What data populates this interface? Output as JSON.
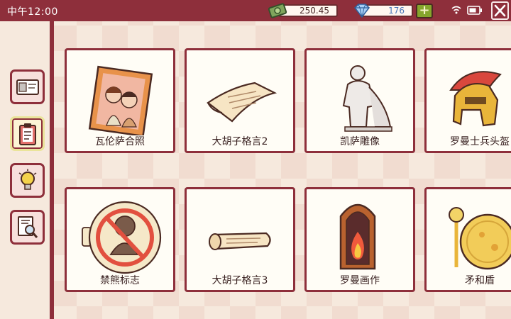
{
  "status_bar": {
    "time": "中午12:00",
    "money": "250.45",
    "gems": "176",
    "plus_label": "+",
    "icons": [
      "money-icon",
      "gem-icon",
      "wifi-icon",
      "battery-icon",
      "close-icon"
    ]
  },
  "sidebar": {
    "tabs": [
      {
        "icon": "id-card-icon",
        "active": false
      },
      {
        "icon": "clipboard-icon",
        "active": true
      },
      {
        "icon": "lightbulb-icon",
        "active": false
      },
      {
        "icon": "magnifier-document-icon",
        "active": false
      }
    ]
  },
  "items": [
    {
      "label": "瓦伦萨合照",
      "icon": "photo-frame-icon"
    },
    {
      "label": "大胡子格言2",
      "icon": "paper-note-icon"
    },
    {
      "label": "凯萨雕像",
      "icon": "statue-icon"
    },
    {
      "label": "罗曼士兵头盔",
      "icon": "roman-helmet-icon"
    },
    {
      "label": "禁熊标志",
      "icon": "no-bear-sign-icon"
    },
    {
      "label": "大胡子格言3",
      "icon": "scroll-icon"
    },
    {
      "label": "罗曼画作",
      "icon": "fire-painting-icon"
    },
    {
      "label": "矛和盾",
      "icon": "spear-shield-icon"
    }
  ],
  "colors": {
    "accent": "#8e2f3b",
    "background": "#f6e9dd",
    "card": "#fffdf6",
    "plus": "#85a52c",
    "gem_text": "#4a78b9"
  }
}
